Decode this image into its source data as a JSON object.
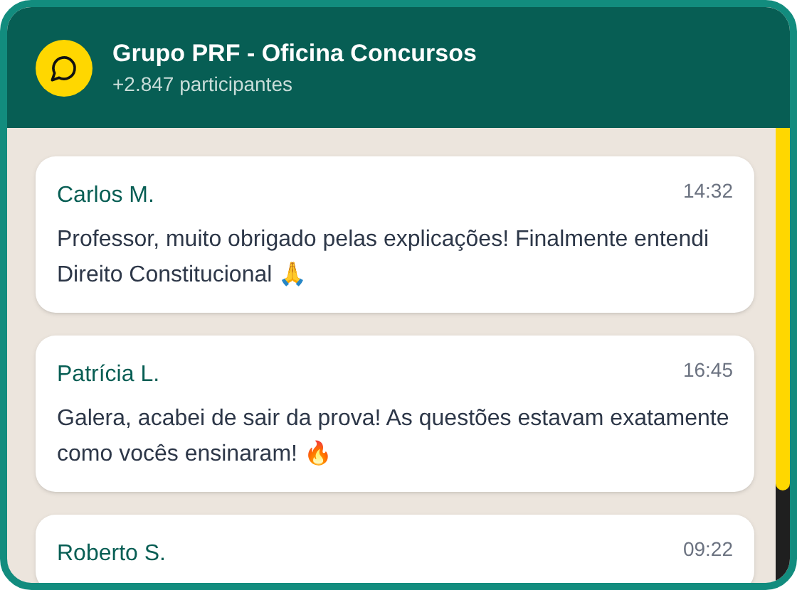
{
  "header": {
    "title": "Grupo PRF - Oficina Concursos",
    "subtitle": "+2.847 participantes"
  },
  "messages": [
    {
      "author": "Carlos M.",
      "time": "14:32",
      "text": "Professor, muito obrigado pelas explicações! Finalmente entendi Direito Constitucional 🙏"
    },
    {
      "author": "Patrícia L.",
      "time": "16:45",
      "text": "Galera, acabei de sair da prova! As questões estavam exatamente como vocês ensinaram! 🔥"
    },
    {
      "author": "Roberto S.",
      "time": "09:22"
    }
  ]
}
